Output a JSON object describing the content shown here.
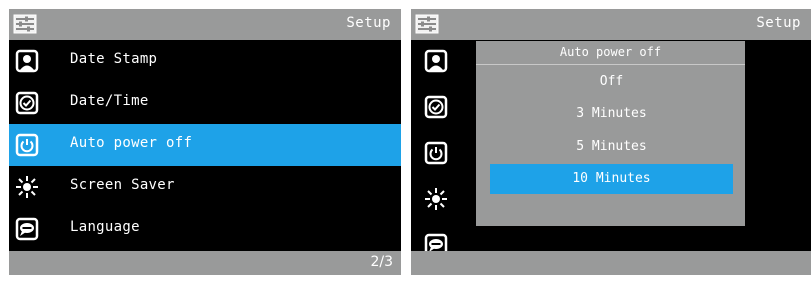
{
  "left_screen": {
    "title": "Setup",
    "menu_items": [
      {
        "label": "Date Stamp",
        "icon": "portrait-icon"
      },
      {
        "label": "Date/Time",
        "icon": "clock-check-icon"
      },
      {
        "label": "Auto power off",
        "icon": "power-icon"
      },
      {
        "label": "Screen Saver",
        "icon": "sun-icon"
      },
      {
        "label": "Language",
        "icon": "abc-bubble-icon"
      }
    ],
    "selected_index": 2,
    "page_indicator": "2/3"
  },
  "right_screen": {
    "title": "Setup",
    "popup": {
      "title": "Auto power off",
      "options": [
        "Off",
        "3 Minutes",
        "5 Minutes",
        "10 Minutes"
      ],
      "selected_option": "10 Minutes"
    }
  },
  "colors": {
    "header_bar": "#999a9a",
    "selection": "#1ea2e8",
    "background": "#000000"
  }
}
